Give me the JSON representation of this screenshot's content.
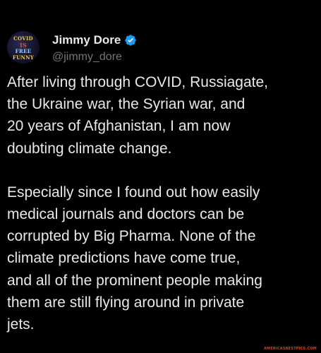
{
  "tweet": {
    "author": {
      "display_name": "Jimmy Dore",
      "handle": "@jimmy_dore",
      "verified": true,
      "avatar": {
        "lines": [
          "COVID",
          "IS",
          "FREE",
          "FUNNY"
        ]
      }
    },
    "paragraphs": [
      "After living through COVID, Russiagate,\nthe Ukraine war, the Syrian war, and\n20 years of Afghanistan, I am now\ndoubting climate change.",
      "Especially since I found out how easily\nmedical journals and doctors can be\ncorrupted by Big Pharma. None of the\nclimate predictions have come true,\nand all of the prominent people making\nthem are still flying around in private\njets."
    ]
  },
  "watermark": "AMERICASBESTPICS.COM",
  "colors": {
    "background": "#000000",
    "text": "#e7e9ea",
    "handle": "#71767b",
    "verified": "#1d9bf0"
  }
}
